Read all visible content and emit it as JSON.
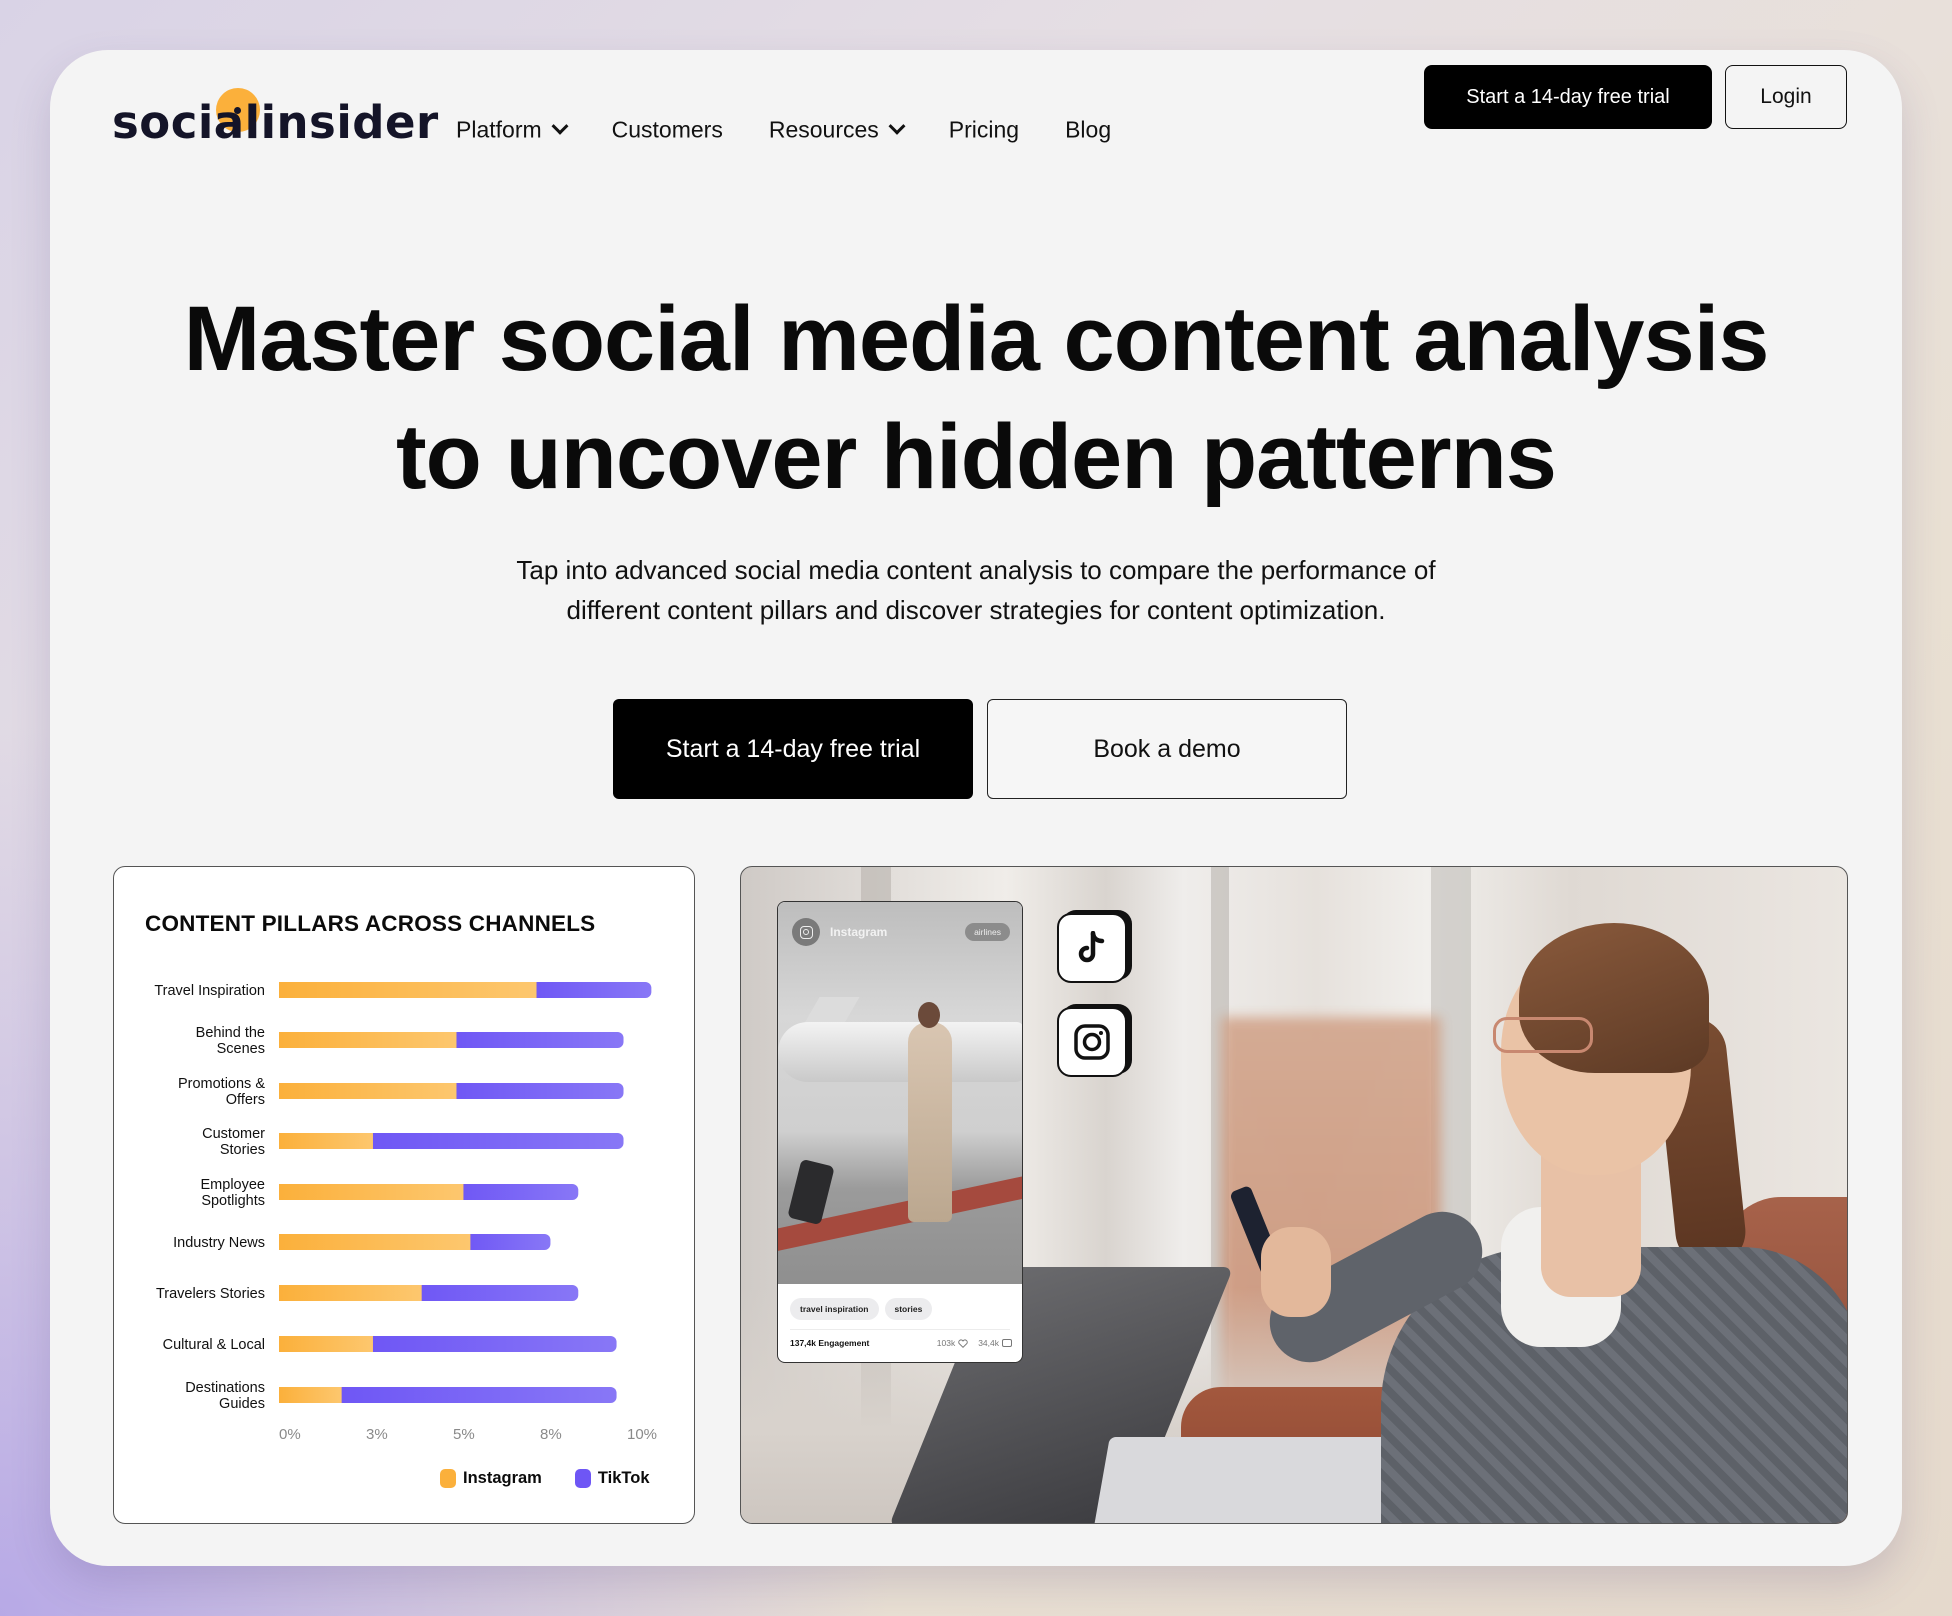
{
  "brand": {
    "name": "socialinsider",
    "accent": "#fbb03b",
    "text_color": "#141428"
  },
  "nav": {
    "items": [
      {
        "label": "Platform",
        "has_dropdown": true
      },
      {
        "label": "Customers",
        "has_dropdown": false
      },
      {
        "label": "Resources",
        "has_dropdown": true
      },
      {
        "label": "Pricing",
        "has_dropdown": false
      },
      {
        "label": "Blog",
        "has_dropdown": false
      }
    ],
    "trial_button": "Start a 14-day free trial",
    "login_button": "Login"
  },
  "hero": {
    "title_line1": "Master social media content analysis",
    "title_line2": "to uncover hidden patterns",
    "subtitle_line1": "Tap into advanced social media content analysis to compare the performance of",
    "subtitle_line2": "different content pillars and discover strategies for content optimization.",
    "primary_cta": "Start a 14-day free trial",
    "secondary_cta": "Book a demo"
  },
  "chart_data": {
    "type": "bar",
    "orientation": "horizontal",
    "stacked": true,
    "title": "CONTENT PILLARS ACROSS CHANNELS",
    "xlabel": "",
    "ylabel": "",
    "xlim": [
      0,
      10
    ],
    "x_ticks": [
      0,
      2.5,
      5,
      7.5,
      10
    ],
    "x_tick_labels": [
      "0%",
      "3%",
      "5%",
      "8%",
      "10%"
    ],
    "grid": false,
    "legend_position": "bottom-right",
    "categories": [
      [
        "Travel Inspiration"
      ],
      [
        "Behind the",
        "Scenes"
      ],
      [
        "Promotions &",
        "Offers"
      ],
      [
        "Customer",
        "Stories"
      ],
      [
        "Employee",
        "Spotlights"
      ],
      [
        "Industry News"
      ],
      [
        "Travelers Stories"
      ],
      [
        "Cultural & Local"
      ],
      [
        "Destinations",
        "Guides"
      ]
    ],
    "series": [
      {
        "name": "Instagram",
        "color": "#fbb03b",
        "color_end": "#fdc76e",
        "values": [
          7.4,
          5.1,
          5.1,
          2.7,
          5.3,
          5.5,
          4.1,
          2.7,
          1.8
        ]
      },
      {
        "name": "TikTok",
        "color": "#6e56f5",
        "color_end": "#8877f6",
        "values": [
          3.3,
          4.8,
          4.8,
          7.2,
          3.3,
          2.3,
          4.5,
          7.0,
          7.9
        ]
      }
    ]
  },
  "photo_overlay": {
    "post_card": {
      "platform": "Instagram",
      "chip": "airlines",
      "tags": [
        "travel inspiration",
        "stories"
      ],
      "engagement": "137,4k Engagement",
      "likes": "103k",
      "comments": "34,4k"
    },
    "social_icons": [
      "tiktok-icon",
      "instagram-icon"
    ]
  }
}
